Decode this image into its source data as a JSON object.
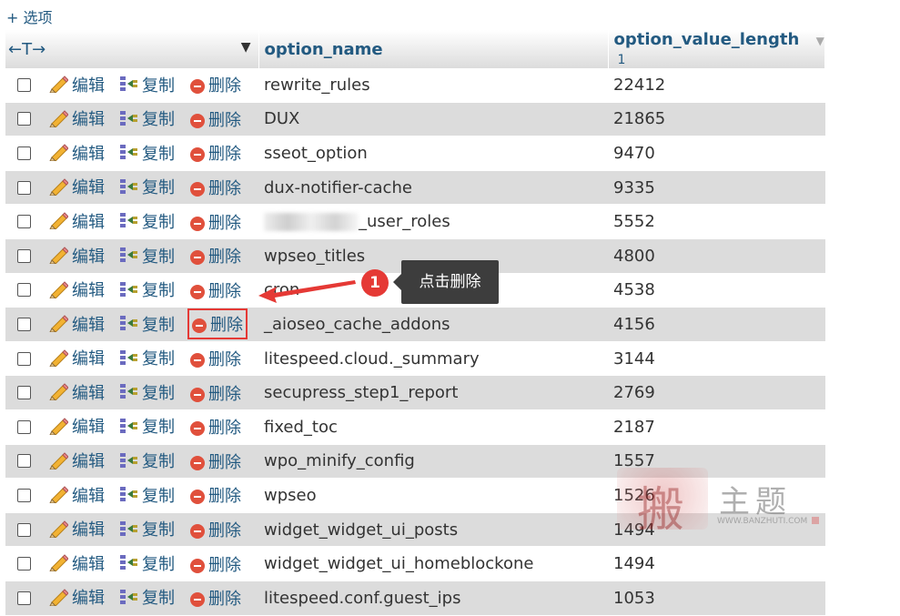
{
  "options_link": "+ 选项",
  "header": {
    "arrows": "←T→",
    "sort_icon": "triangle-down",
    "col_name": "option_name",
    "col_length": "option_value_length",
    "sort_desc": "▼",
    "sort_index": "1"
  },
  "actions": {
    "edit": "编辑",
    "copy": "复制",
    "delete": "删除"
  },
  "rows": [
    {
      "name": "rewrite_rules",
      "length": "22412"
    },
    {
      "name": "DUX",
      "length": "21865"
    },
    {
      "name": "sseot_option",
      "length": "9470"
    },
    {
      "name": "dux-notifier-cache",
      "length": "9335"
    },
    {
      "name": "_user_roles",
      "length": "5552",
      "blurred_prefix": true
    },
    {
      "name": "wpseo_titles",
      "length": "4800"
    },
    {
      "name": "cron",
      "length": "4538"
    },
    {
      "name": "_aioseo_cache_addons",
      "length": "4156",
      "highlighted_delete": true
    },
    {
      "name": "litespeed.cloud._summary",
      "length": "3144"
    },
    {
      "name": "secupress_step1_report",
      "length": "2769"
    },
    {
      "name": "fixed_toc",
      "length": "2187"
    },
    {
      "name": "wpo_minify_config",
      "length": "1557"
    },
    {
      "name": "wpseo",
      "length": "1526"
    },
    {
      "name": "widget_widget_ui_posts",
      "length": "1494"
    },
    {
      "name": "widget_widget_ui_homeblockone",
      "length": "1494"
    },
    {
      "name": "litespeed.conf.guest_ips",
      "length": "1053"
    }
  ],
  "callout": {
    "number": "1",
    "text": "点击删除"
  },
  "watermark": {
    "seal": "搬",
    "title": "主题",
    "url": "WWW.BANZHUTI.COM"
  },
  "colors": {
    "link": "#235a81",
    "row_alt": "#dcdcdc",
    "callout_red": "#e53935",
    "callout_bg": "#3d3d3d"
  }
}
